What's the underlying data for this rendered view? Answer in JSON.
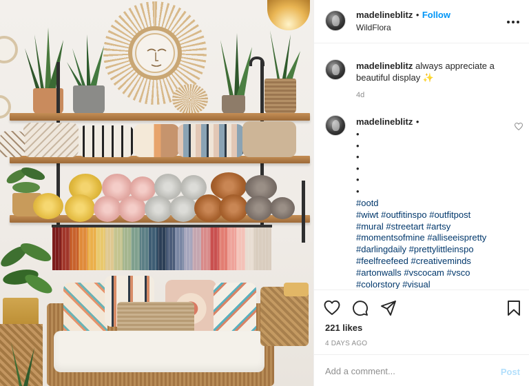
{
  "header": {
    "username": "madelineblitz",
    "separator": "•",
    "follow_label": "Follow",
    "location": "WildFlora",
    "more_icon": "more-horizontal-icon"
  },
  "caption_comment": {
    "username": "madelineblitz",
    "text": "always appreciate a beautiful display ✨",
    "time": "4d"
  },
  "second_comment": {
    "username": "madelineblitz",
    "separator": "•",
    "bullets": [
      "•",
      "•",
      "•",
      "•",
      "•",
      "•"
    ],
    "hashtag_lines": [
      "#ootd",
      "#wiwt #outfitinspo #outfitpost",
      "#mural #streetart #artsy",
      "#momentsofmine #alliseeispretty",
      "#darlingdaily #prettylittleinspo",
      "#feelfreefeed #creativeminds",
      "#artonwalls #vscocam #vsco",
      "#colorstory #visual"
    ],
    "heart_icon": "heart-outline-icon"
  },
  "actions": {
    "icons": [
      "heart-icon",
      "comment-icon",
      "share-icon",
      "bookmark-icon"
    ],
    "likes": "221 likes",
    "time_ago": "4 DAYS AGO"
  },
  "comment_box": {
    "placeholder": "Add a comment...",
    "post_label": "Post"
  },
  "colors": {
    "follow_blue": "#0095f6",
    "hashtag_blue": "#00376b",
    "post_disabled": "#b2dffc",
    "muted_gray": "#8e8e8e"
  }
}
